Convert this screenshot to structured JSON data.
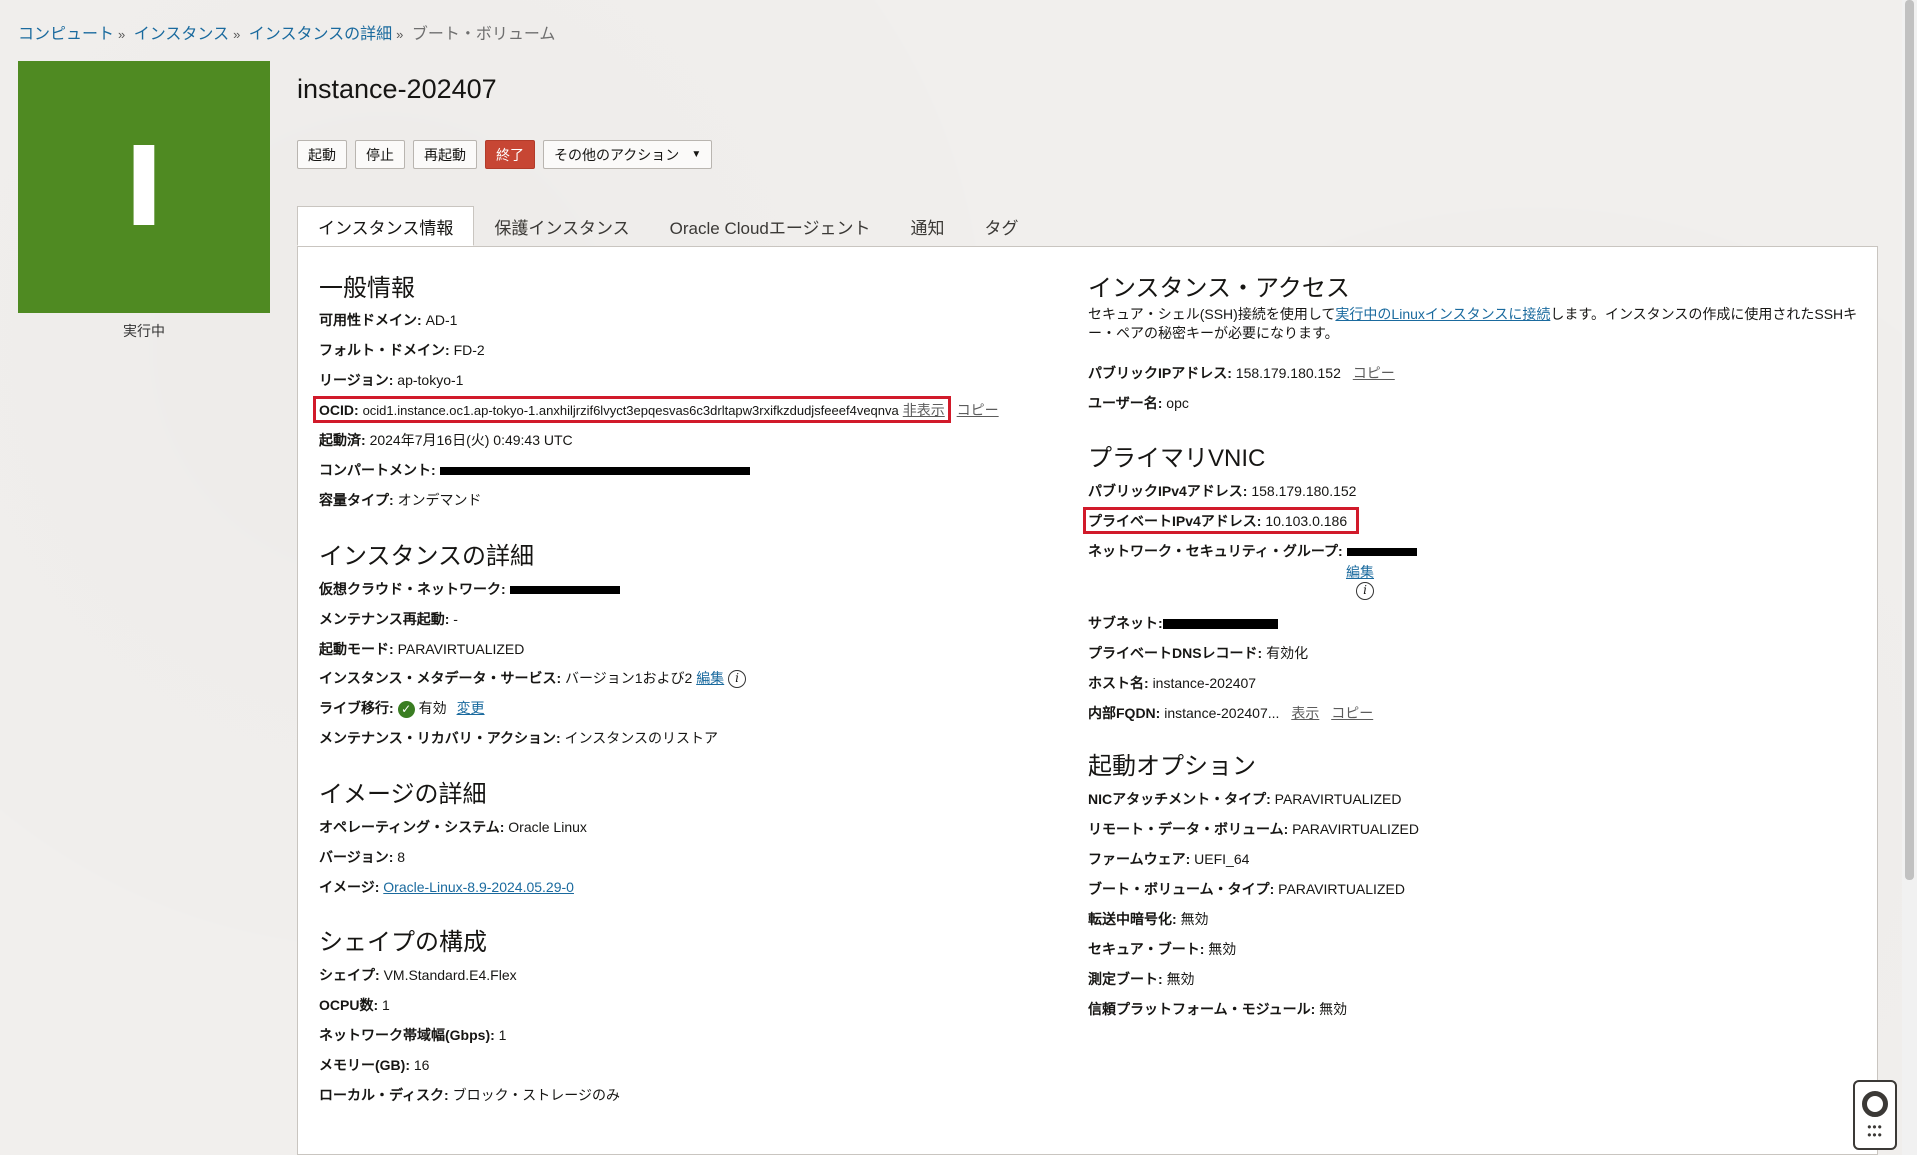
{
  "breadcrumb": {
    "items": [
      "コンピュート",
      "インスタンス",
      "インスタンスの詳細"
    ],
    "separator": "»",
    "current": "ブート・ボリューム"
  },
  "tile": {
    "letter": "I",
    "status": "実行中",
    "color": "#4f8a22"
  },
  "title": "instance-202407",
  "actions": {
    "start": "起動",
    "stop": "停止",
    "reboot": "再起動",
    "terminate": "終了",
    "more": "その他のアクション"
  },
  "tabs": [
    "インスタンス情報",
    "保護インスタンス",
    "Oracle Cloudエージェント",
    "通知",
    "タグ"
  ],
  "general": {
    "title": "一般情報",
    "ad_k": "可用性ドメイン:",
    "ad_v": "AD-1",
    "fd_k": "フォルト・ドメイン:",
    "fd_v": "FD-2",
    "region_k": "リージョン:",
    "region_v": "ap-tokyo-1",
    "ocid_k": "OCID:",
    "ocid_v": "ocid1.instance.oc1.ap-tokyo-1.anxhiljrzif6lvyct3epqesvas6c3drltapw3rxifkzdudjsfeeef4veqnva",
    "ocid_hide": "非表示",
    "ocid_copy": "コピー",
    "launched_k": "起動済:",
    "launched_v": "2024年7月16日(火) 0:49:43 UTC",
    "compartment_k": "コンパートメント:",
    "capacity_k": "容量タイプ:",
    "capacity_v": "オンデマンド"
  },
  "instance_details": {
    "title": "インスタンスの詳細",
    "vcn_k": "仮想クラウド・ネットワーク:",
    "maint_k": "メンテナンス再起動:",
    "maint_v": "-",
    "launch_mode_k": "起動モード:",
    "launch_mode_v": "PARAVIRTUALIZED",
    "imds_k": "インスタンス・メタデータ・サービス:",
    "imds_v": "バージョン1および2",
    "imds_edit": "編集",
    "live_k": "ライブ移行:",
    "live_v": "有効",
    "live_change": "変更",
    "recovery_k": "メンテナンス・リカバリ・アクション:",
    "recovery_v": "インスタンスのリストア"
  },
  "image": {
    "title": "イメージの詳細",
    "os_k": "オペレーティング・システム:",
    "os_v": "Oracle Linux",
    "ver_k": "バージョン:",
    "ver_v": "8",
    "image_k": "イメージ:",
    "image_v": "Oracle-Linux-8.9-2024.05.29-0"
  },
  "shape": {
    "title": "シェイプの構成",
    "shape_k": "シェイプ:",
    "shape_v": "VM.Standard.E4.Flex",
    "ocpu_k": "OCPU数:",
    "ocpu_v": "1",
    "bw_k": "ネットワーク帯域幅(Gbps):",
    "bw_v": "1",
    "mem_k": "メモリー(GB):",
    "mem_v": "16",
    "disk_k": "ローカル・ディスク:",
    "disk_v": "ブロック・ストレージのみ"
  },
  "access": {
    "title": "インスタンス・アクセス",
    "desc_pre": "セキュア・シェル(SSH)接続を使用して",
    "desc_link": "実行中のLinuxインスタンスに接続",
    "desc_post": "します。インスタンスの作成に使用されたSSHキー・ペアの秘密キーが必要になります。",
    "public_ip_k": "パブリックIPアドレス:",
    "public_ip_v": "158.179.180.152",
    "public_ip_copy": "コピー",
    "user_k": "ユーザー名:",
    "user_v": "opc"
  },
  "vnic": {
    "title": "プライマリVNIC",
    "pub_k": "パブリックIPv4アドレス:",
    "pub_v": "158.179.180.152",
    "priv_k": "プライベートIPv4アドレス:",
    "priv_v": "10.103.0.186",
    "nsg_k": "ネットワーク・セキュリティ・グループ:",
    "nsg_edit": "編集",
    "subnet_k": "サブネット:",
    "dns_k": "プライベートDNSレコード:",
    "dns_v": "有効化",
    "host_k": "ホスト名:",
    "host_v": "instance-202407",
    "fqdn_k": "内部FQDN:",
    "fqdn_v": "instance-202407...",
    "fqdn_show": "表示",
    "fqdn_copy": "コピー"
  },
  "launch": {
    "title": "起動オプション",
    "nic_k": "NICアタッチメント・タイプ:",
    "nic_v": "PARAVIRTUALIZED",
    "remote_k": "リモート・データ・ボリューム:",
    "remote_v": "PARAVIRTUALIZED",
    "fw_k": "ファームウェア:",
    "fw_v": "UEFI_64",
    "boot_k": "ブート・ボリューム・タイプ:",
    "boot_v": "PARAVIRTUALIZED",
    "transit_k": "転送中暗号化:",
    "transit_v": "無効",
    "secure_k": "セキュア・ブート:",
    "secure_v": "無効",
    "measured_k": "測定ブート:",
    "measured_v": "無効",
    "tpm_k": "信頼プラットフォーム・モジュール:",
    "tpm_v": "無効"
  }
}
